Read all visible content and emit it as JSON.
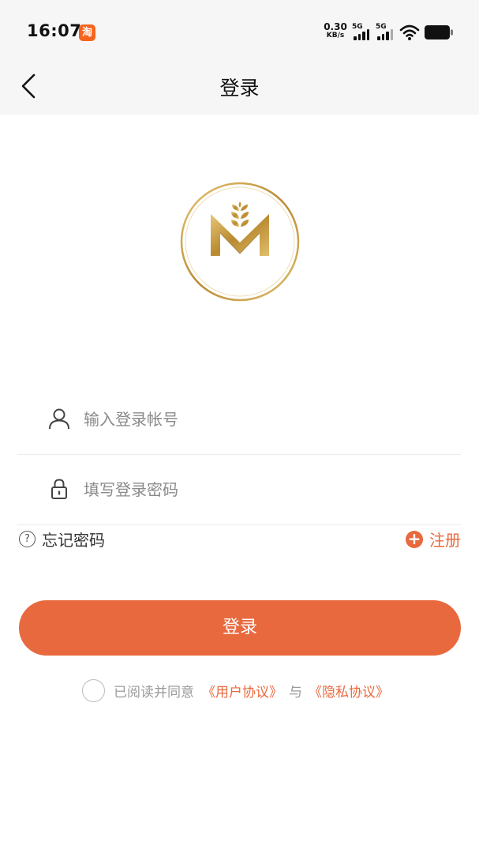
{
  "status_bar": {
    "time": "16:07",
    "app_badge": "淘",
    "net_speed_value": "0.30",
    "net_speed_unit": "KB/s",
    "sim1_label": "5G",
    "sim2_label": "5G",
    "icons": [
      "taobao-icon",
      "signal-icon",
      "wifi-icon",
      "battery-icon"
    ]
  },
  "header": {
    "back_icon": "chevron-left-icon",
    "title": "登录"
  },
  "logo": {
    "icon": "wheat-m-logo"
  },
  "form": {
    "account": {
      "placeholder": "输入登录帐号",
      "value": "",
      "icon": "user-icon"
    },
    "password": {
      "placeholder": "填写登录密码",
      "value": "",
      "icon": "lock-icon"
    }
  },
  "links": {
    "forgot_password": "忘记密码",
    "forgot_icon": "question-icon",
    "register": "注册",
    "register_icon": "plus-circle-icon"
  },
  "login_button": "登录",
  "agreement": {
    "prefix": "已阅读并同意",
    "user_agreement": "《用户协议》",
    "and": "与",
    "privacy_agreement": "《隐私协议》"
  },
  "colors": {
    "accent": "#e8693e",
    "header_bg": "#f6f6f6",
    "gold": "#c9a24a"
  }
}
